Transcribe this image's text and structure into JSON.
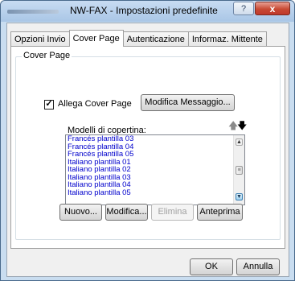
{
  "window": {
    "title": "NW-FAX - Impostazioni predefinite",
    "help_label": "?",
    "close_label": "x"
  },
  "tabs": [
    {
      "label": "Opzioni Invio"
    },
    {
      "label": "Cover Page"
    },
    {
      "label": "Autenticazione"
    },
    {
      "label": "Informaz. Mittente"
    }
  ],
  "cover_page": {
    "group_label": "Cover Page",
    "attach_label": "Allega Cover Page",
    "attach_checked": "✓",
    "edit_message_label": "Modifica Messaggio...",
    "list_label": "Modelli di copertina:",
    "move_up_icon": "🡅",
    "move_down_icon": "🡇",
    "templates": [
      "Francés plantilla 03",
      "Francés plantilla 04",
      "Francés plantilla 05",
      "Italiano plantilla 01",
      "Italiano plantilla 02",
      "Italiano plantilla 03",
      "Italiano plantilla 04",
      "Italiano plantilla 05"
    ],
    "buttons": {
      "new": "Nuovo...",
      "edit": "Modifica...",
      "delete": "Elimina",
      "preview": "Anteprima"
    }
  },
  "footer": {
    "ok": "OK",
    "cancel": "Annulla"
  }
}
